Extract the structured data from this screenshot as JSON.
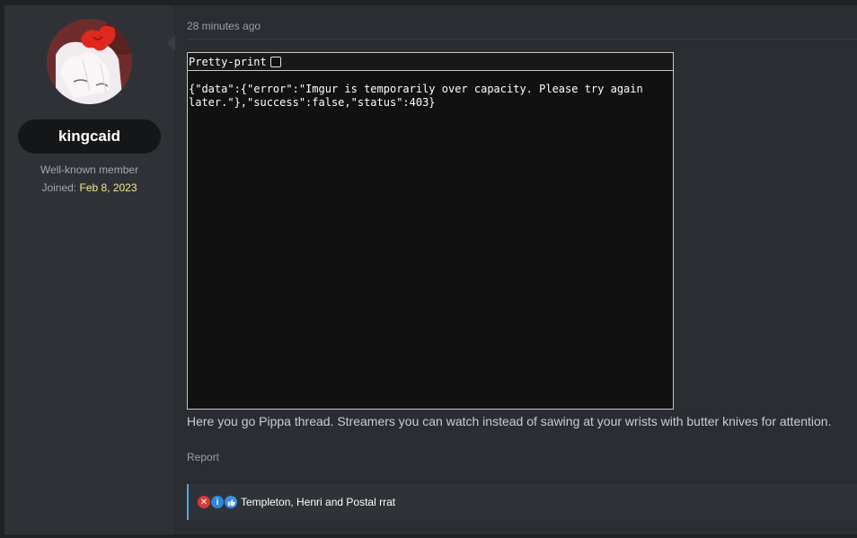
{
  "user": {
    "username": "kingcaid",
    "title": "Well-known member",
    "joined_label": "Joined:",
    "joined_date": "Feb 8, 2023"
  },
  "post": {
    "timestamp": "28 minutes ago",
    "viewer": {
      "toolbar_label": "Pretty-print",
      "json_text": "{\"data\":{\"error\":\"Imgur is temporarily over capacity. Please try again\nlater.\"},\"success\":false,\"status\":403}"
    },
    "body": "Here you go Pippa thread. Streamers you can watch instead of sawing at your wrists with butter knives for attention.",
    "report_label": "Report",
    "reactions": {
      "icons": [
        "x-reaction-icon",
        "info-reaction-icon",
        "like-reaction-icon"
      ],
      "names": "Templeton, Henri and Postal rrat"
    }
  },
  "colors": {
    "accent_blue": "#47a7eb",
    "joined_date": "#f0e68c",
    "reaction_x": "#d53a3a"
  }
}
